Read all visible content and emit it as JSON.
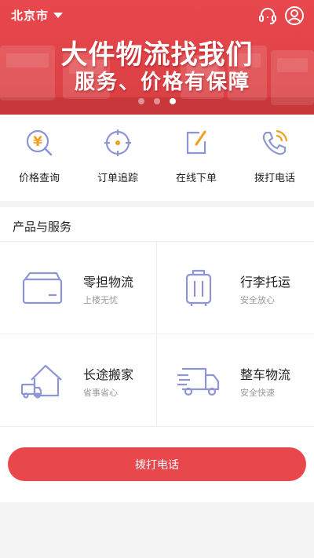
{
  "header": {
    "city": "北京市",
    "icons": [
      "service-headset-icon",
      "user-profile-icon"
    ]
  },
  "banner": {
    "headline": "大件物流找我们",
    "subheadline": "服务、价格有保障",
    "carousel": {
      "total": 3,
      "active_index": 3
    }
  },
  "quick_actions": [
    {
      "label": "价格查询",
      "icon": "price-query-icon"
    },
    {
      "label": "订单追踪",
      "icon": "order-track-icon"
    },
    {
      "label": "在线下单",
      "icon": "online-order-icon"
    },
    {
      "label": "拨打电话",
      "icon": "phone-call-icon"
    }
  ],
  "products": {
    "title": "产品与服务",
    "items": [
      {
        "title": "零担物流",
        "subtitle": "上楼无忧",
        "icon": "package-box-icon"
      },
      {
        "title": "行李托运",
        "subtitle": "安全放心",
        "icon": "luggage-icon"
      },
      {
        "title": "长途搬家",
        "subtitle": "省事省心",
        "icon": "house-moving-icon"
      },
      {
        "title": "整车物流",
        "subtitle": "安全快速",
        "icon": "delivery-truck-icon"
      }
    ]
  },
  "call_button": {
    "label": "拨打电话"
  },
  "colors": {
    "brand_red": "#e8474c",
    "icon_blue": "#8d95d6",
    "icon_orange": "#f0a020"
  }
}
